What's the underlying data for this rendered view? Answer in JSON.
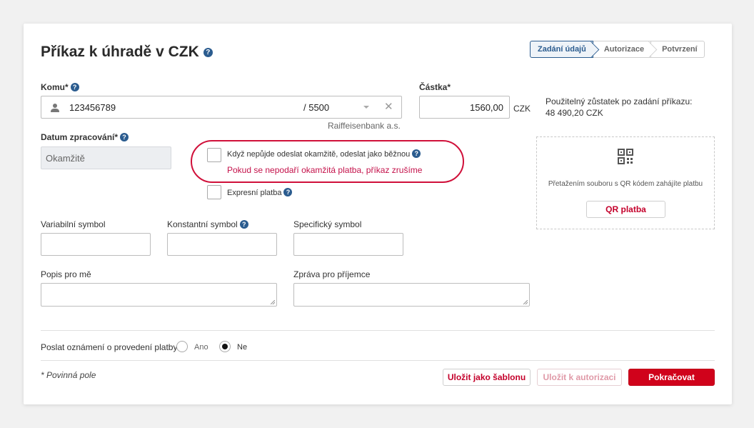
{
  "page": {
    "title": "Příkaz k úhradě v CZK",
    "steps": [
      "Zadání údajů",
      "Autorizace",
      "Potvrzení"
    ],
    "active_step": 0
  },
  "form": {
    "komu_label": "Komu*",
    "account_number": "123456789",
    "bank_code": "/ 5500",
    "bank_name": "Raiffeisenbank a.s.",
    "amount_label": "Částka*",
    "amount_value": "1560,00",
    "currency": "CZK",
    "available_label": "Použitelný zůstatek po zadání příkazu:",
    "available_value": "48 490,20 CZK",
    "date_label": "Datum zpracování*",
    "date_value": "Okamžitě",
    "fallback_checkbox_label": "Když nepůjde odeslat okamžitě, odeslat jako běžnou",
    "fallback_note": "Pokud se nepodaří okamžitá platba, příkaz zrušíme",
    "express_label": "Expresní platba",
    "variable_symbol_label": "Variabilní symbol",
    "constant_symbol_label": "Konstantní symbol",
    "specific_symbol_label": "Specifický symbol",
    "note_for_me_label": "Popis pro mě",
    "message_label": "Zpráva pro příjemce",
    "notify_label": "Poslat oznámení o provedení platby",
    "notify_yes": "Ano",
    "notify_no": "Ne",
    "notify_selected": "Ne",
    "required_note": "* Povinná pole"
  },
  "qr": {
    "drop_text": "Přetažením souboru s QR kódem zahájíte platbu",
    "button_label": "QR platba"
  },
  "actions": {
    "save_template": "Uložit jako šablonu",
    "save_authorize": "Uložit k autorizaci",
    "continue": "Pokračovat"
  },
  "colors": {
    "brand_red": "#d0021b",
    "help_blue": "#2b5c8f",
    "highlight_red": "#d0103a"
  }
}
